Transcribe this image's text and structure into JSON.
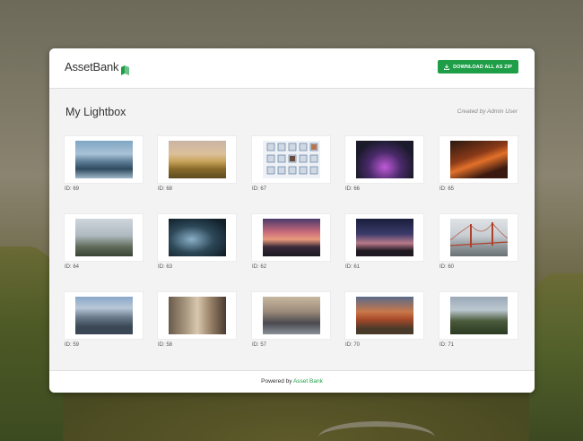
{
  "header": {
    "brand": "AssetBank",
    "download_button": "DOWNLOAD ALL AS ZIP"
  },
  "lightbox": {
    "title": "My Lightbox",
    "created_by": "Created by Admin User"
  },
  "items": [
    {
      "id_label": "ID: 69",
      "icon": "lake-mountain-thumbnail"
    },
    {
      "id_label": "ID: 68",
      "icon": "balloon-field-thumbnail"
    },
    {
      "id_label": "ID: 67",
      "icon": "building-windows-thumbnail"
    },
    {
      "id_label": "ID: 66",
      "icon": "night-bridge-thumbnail"
    },
    {
      "id_label": "ID: 65",
      "icon": "london-night-thumbnail"
    },
    {
      "id_label": "ID: 64",
      "icon": "misty-mountain-thumbnail"
    },
    {
      "id_label": "ID: 63",
      "icon": "aerial-river-thumbnail"
    },
    {
      "id_label": "ID: 62",
      "icon": "sunset-sea-thumbnail"
    },
    {
      "id_label": "ID: 61",
      "icon": "dusk-horizon-thumbnail"
    },
    {
      "id_label": "ID: 60",
      "icon": "golden-gate-thumbnail"
    },
    {
      "id_label": "ID: 59",
      "icon": "snowy-mountains-thumbnail"
    },
    {
      "id_label": "ID: 58",
      "icon": "city-street-thumbnail"
    },
    {
      "id_label": "ID: 57",
      "icon": "pier-sunset-thumbnail"
    },
    {
      "id_label": "ID: 70",
      "icon": "red-canyon-thumbnail"
    },
    {
      "id_label": "ID: 71",
      "icon": "castle-forest-thumbnail"
    }
  ],
  "footer": {
    "prefix": "Powered by",
    "link": "Asset Bank"
  },
  "colors": {
    "accent": "#1f9e48"
  }
}
